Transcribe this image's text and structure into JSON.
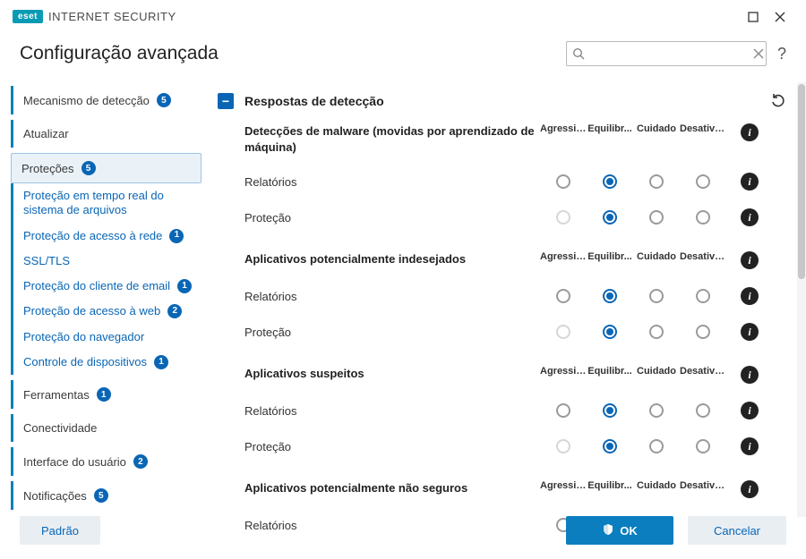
{
  "brand": {
    "badge": "eset",
    "name": "INTERNET SECURITY"
  },
  "page_title": "Configuração avançada",
  "search": {
    "placeholder": ""
  },
  "sidebar": {
    "items": [
      {
        "label": "Mecanismo de detecção",
        "badge": "5",
        "type": "top"
      },
      {
        "label": "Atualizar",
        "type": "top"
      },
      {
        "label": "Proteções",
        "badge": "5",
        "type": "top",
        "selected": true
      },
      {
        "label": "Proteção em tempo real do sistema de arquivos",
        "type": "sub"
      },
      {
        "label": "Proteção de acesso à rede",
        "badge": "1",
        "type": "sub"
      },
      {
        "label": "SSL/TLS",
        "type": "sub"
      },
      {
        "label": "Proteção do cliente de email",
        "badge": "1",
        "type": "sub"
      },
      {
        "label": "Proteção de acesso à web",
        "badge": "2",
        "type": "sub"
      },
      {
        "label": "Proteção do navegador",
        "type": "sub"
      },
      {
        "label": "Controle de dispositivos",
        "badge": "1",
        "type": "sub"
      },
      {
        "label": "Ferramentas",
        "badge": "1",
        "type": "top"
      },
      {
        "label": "Conectividade",
        "type": "top"
      },
      {
        "label": "Interface do usuário",
        "badge": "2",
        "type": "top"
      },
      {
        "label": "Notificações",
        "badge": "5",
        "type": "top"
      }
    ]
  },
  "panel": {
    "title": "Respostas de detecção"
  },
  "level_labels": [
    "Agressivo",
    "Equilibr...",
    "Cuidado",
    "Desativa..."
  ],
  "groups": [
    {
      "title": "Detecções de malware (movidas por aprendizado de máquina)",
      "rows": [
        {
          "label": "Relatórios",
          "selected": 1,
          "dim_first": false
        },
        {
          "label": "Proteção",
          "selected": 1,
          "dim_first": true
        }
      ]
    },
    {
      "title": "Aplicativos potencialmente indesejados",
      "rows": [
        {
          "label": "Relatórios",
          "selected": 1,
          "dim_first": false
        },
        {
          "label": "Proteção",
          "selected": 1,
          "dim_first": true
        }
      ]
    },
    {
      "title": "Aplicativos suspeitos",
      "rows": [
        {
          "label": "Relatórios",
          "selected": 1,
          "dim_first": false
        },
        {
          "label": "Proteção",
          "selected": 1,
          "dim_first": true
        }
      ]
    },
    {
      "title": "Aplicativos potencialmente não seguros",
      "rows": [
        {
          "label": "Relatórios",
          "selected": 3,
          "dim_first": false
        }
      ]
    }
  ],
  "footer": {
    "default": "Padrão",
    "ok": "OK",
    "cancel": "Cancelar"
  }
}
